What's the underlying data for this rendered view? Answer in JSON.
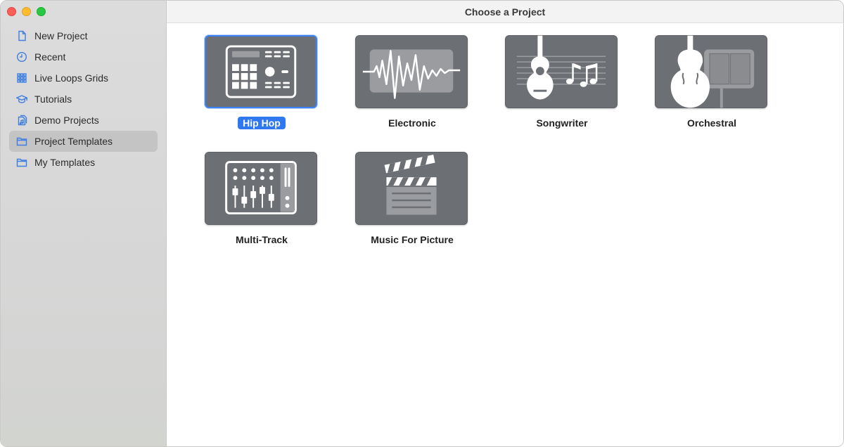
{
  "window": {
    "title": "Choose a Project"
  },
  "sidebar": {
    "items": [
      {
        "label": "New Project",
        "icon": "document-icon",
        "selected": false
      },
      {
        "label": "Recent",
        "icon": "clock-icon",
        "selected": false
      },
      {
        "label": "Live Loops Grids",
        "icon": "grid-icon",
        "selected": false
      },
      {
        "label": "Tutorials",
        "icon": "graduation-cap-icon",
        "selected": false
      },
      {
        "label": "Demo Projects",
        "icon": "document-music-icon",
        "selected": false
      },
      {
        "label": "Project Templates",
        "icon": "folder-icon",
        "selected": true
      },
      {
        "label": "My Templates",
        "icon": "folder-icon",
        "selected": false
      }
    ]
  },
  "templates": [
    {
      "label": "Hip Hop",
      "icon": "drum-machine-icon",
      "selected": true
    },
    {
      "label": "Electronic",
      "icon": "waveform-icon",
      "selected": false
    },
    {
      "label": "Songwriter",
      "icon": "guitar-notes-icon",
      "selected": false
    },
    {
      "label": "Orchestral",
      "icon": "cello-icon",
      "selected": false
    },
    {
      "label": "Multi-Track",
      "icon": "mixer-icon",
      "selected": false
    },
    {
      "label": "Music For Picture",
      "icon": "clapperboard-icon",
      "selected": false
    }
  ],
  "colors": {
    "accent": "#2f78f0",
    "tile": "#6c6f74",
    "sidebar_icon": "#3d7ee0"
  }
}
